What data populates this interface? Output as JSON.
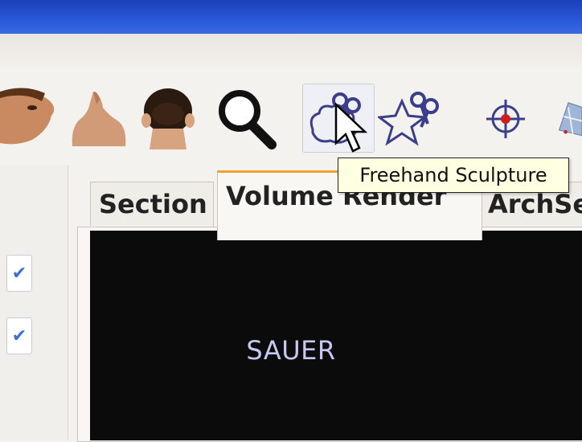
{
  "toolbar": {
    "icons": [
      "face-profile-icon",
      "face-up-icon",
      "head-back-icon",
      "magnifier-icon",
      "freehand-sculpture-icon",
      "sculpture-star-icon",
      "crosshair-icon",
      "map-icon"
    ],
    "active_tool": "freehand-sculpture-icon",
    "tooltip": "Freehand Sculpture"
  },
  "tabs": [
    {
      "label": "Section",
      "selected": false
    },
    {
      "label": "Volume Render",
      "selected": true
    },
    {
      "label": "ArchSe",
      "selected": false
    }
  ],
  "left_panel": {
    "checkboxes": [
      true,
      true
    ]
  },
  "viewport": {
    "text": "SAUER",
    "text_color": "#c6c8f2",
    "background": "#0b0b0b"
  },
  "colors": {
    "titlebar": "#2a58d8",
    "accent_tab": "#f0a030",
    "target_red": "#cc1f1f"
  }
}
